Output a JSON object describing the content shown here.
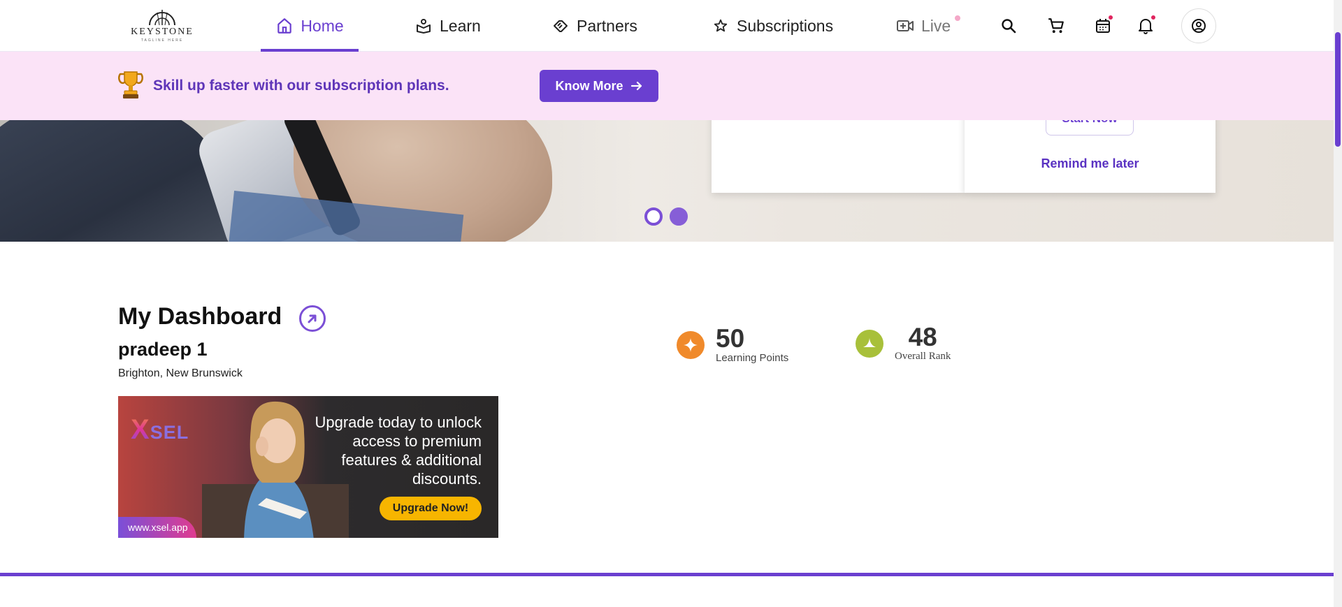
{
  "nav": {
    "logo": {
      "brand": "KEYSTONE",
      "tagline": "TAGLINE HERE"
    },
    "items": [
      {
        "label": "Home",
        "icon": "home-icon"
      },
      {
        "label": "Learn",
        "icon": "learn-icon"
      },
      {
        "label": "Partners",
        "icon": "handshake-icon"
      },
      {
        "label": "Subscriptions",
        "icon": "star-icon"
      },
      {
        "label": "Live",
        "icon": "video-add-icon"
      }
    ],
    "active": "Home"
  },
  "promo": {
    "message": "Skill up faster with our subscription plans.",
    "cta": "Know More"
  },
  "hero_card": {
    "start_label": "Start Now",
    "remind_label": "Remind me later"
  },
  "carousel": {
    "slides": 2,
    "active": 2
  },
  "dashboard": {
    "title": "My Dashboard",
    "user_name": "pradeep 1",
    "location": "Brighton, New Brunswick",
    "stats": [
      {
        "value": "50",
        "label": "Learning Points",
        "color": "#f08a2b"
      },
      {
        "value": "48",
        "label": "Overall Rank",
        "color": "#a8c03a"
      }
    ]
  },
  "ad": {
    "brand": "SEL",
    "brand_mark": "X",
    "text": "Upgrade today to unlock access to premium features & additional discounts.",
    "button": "Upgrade Now!",
    "url": "www.xsel.app"
  },
  "colors": {
    "accent": "#6a3fd0",
    "promo_bg": "#fbe3f7",
    "notification": "#e0245e"
  }
}
